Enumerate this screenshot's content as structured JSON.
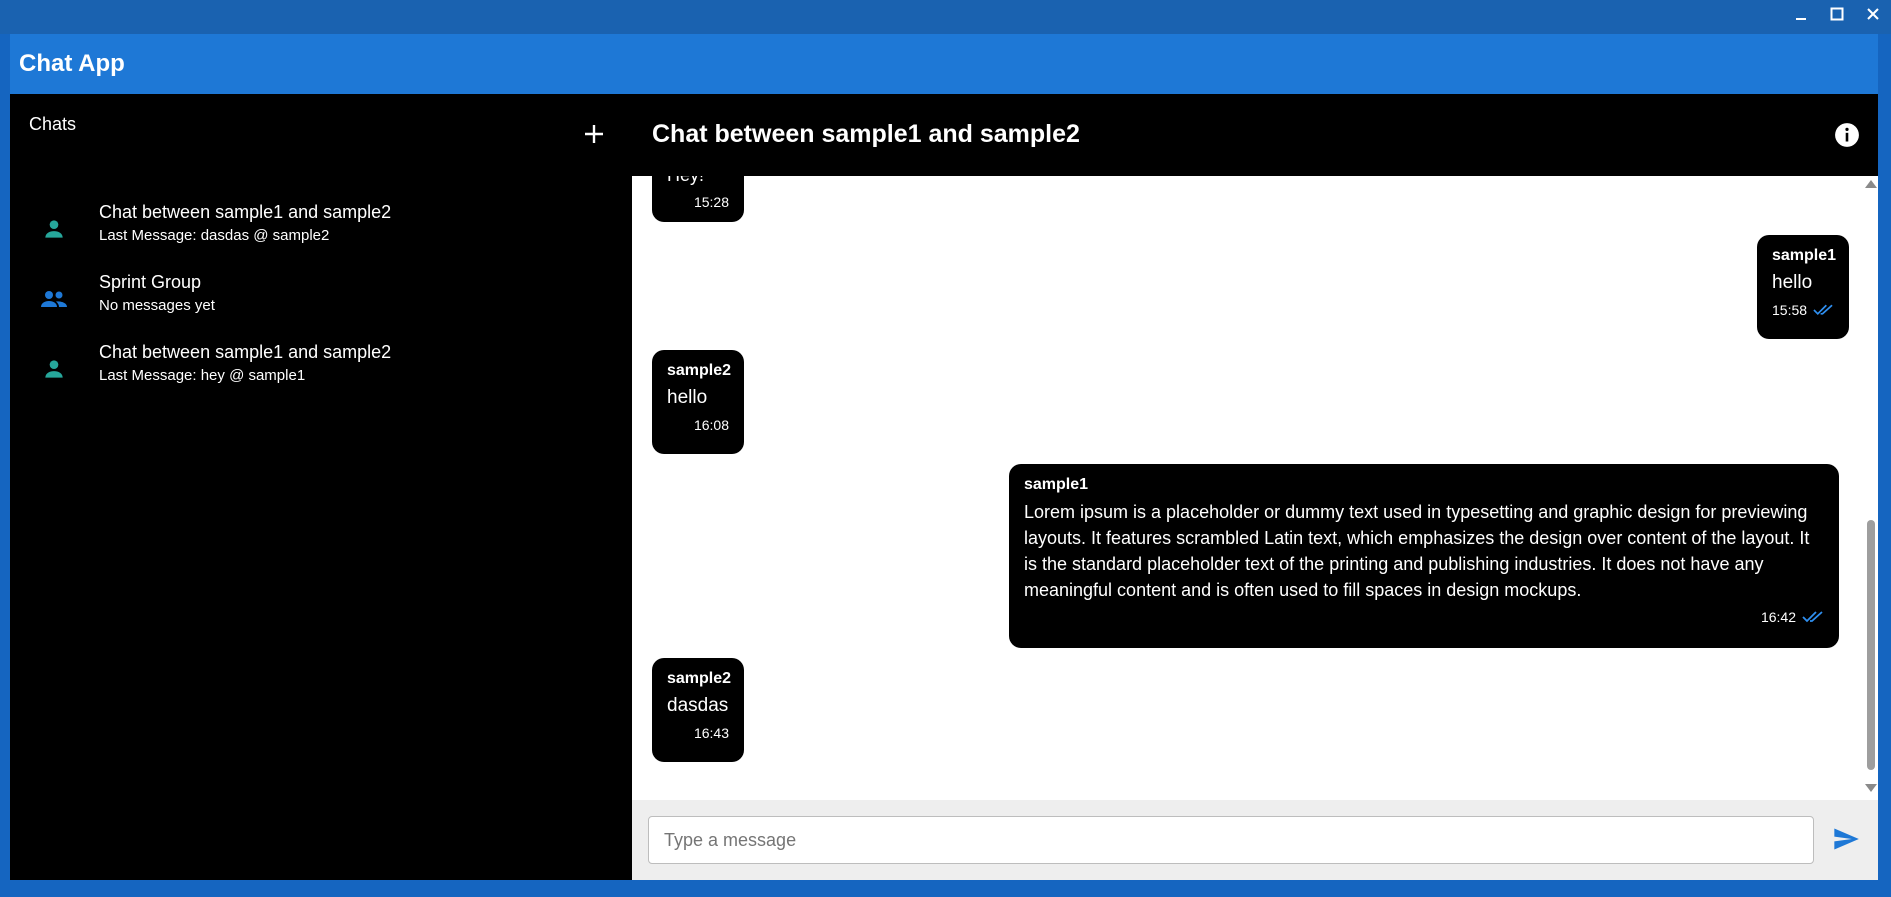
{
  "window": {
    "minimize_label": "_",
    "maximize_label": "□",
    "close_label": "✕"
  },
  "app": {
    "title": "Chat App"
  },
  "sidebar": {
    "title": "Chats",
    "add_icon": "plus-icon",
    "items": [
      {
        "name": "Chat between sample1 and sample2",
        "subtitle": "Last Message: dasdas @ sample2",
        "icon": "person-icon",
        "icon_color": "#26a69a"
      },
      {
        "name": "Sprint Group",
        "subtitle": "No messages yet",
        "icon": "group-icon",
        "icon_color": "#1e78d6"
      },
      {
        "name": "Chat between sample1 and sample2",
        "subtitle": "Last Message: hey @ sample1",
        "icon": "person-icon",
        "icon_color": "#26a69a"
      }
    ]
  },
  "chat": {
    "title": "Chat between sample1 and sample2",
    "info_icon": "info-icon",
    "messages": [
      {
        "sender": "",
        "text": "Hey!",
        "time": "15:28",
        "side": "left",
        "read": false
      },
      {
        "sender": "sample1",
        "text": "hello",
        "time": "15:58",
        "side": "right",
        "read": true
      },
      {
        "sender": "sample2",
        "text": "hello",
        "time": "16:08",
        "side": "left",
        "read": false
      },
      {
        "sender": "sample1",
        "text": "Lorem ipsum is a placeholder or dummy text used in typesetting and graphic design for previewing layouts. It features scrambled Latin text, which emphasizes the design over content of the layout. It is the standard placeholder text of the printing and publishing industries. It does not have any meaningful content and is often used to fill spaces in design mockups.",
        "time": "16:42",
        "side": "right",
        "read": true
      },
      {
        "sender": "sample2",
        "text": "dasdas",
        "time": "16:43",
        "side": "left",
        "read": false
      }
    ]
  },
  "composer": {
    "placeholder": "Type a message",
    "value": "",
    "send_icon": "send-icon"
  },
  "colors": {
    "app_bar": "#1e78d6",
    "title_bar": "#1a62b0",
    "read_receipt": "#2f8ff0",
    "send_icon": "#1e78d6"
  }
}
